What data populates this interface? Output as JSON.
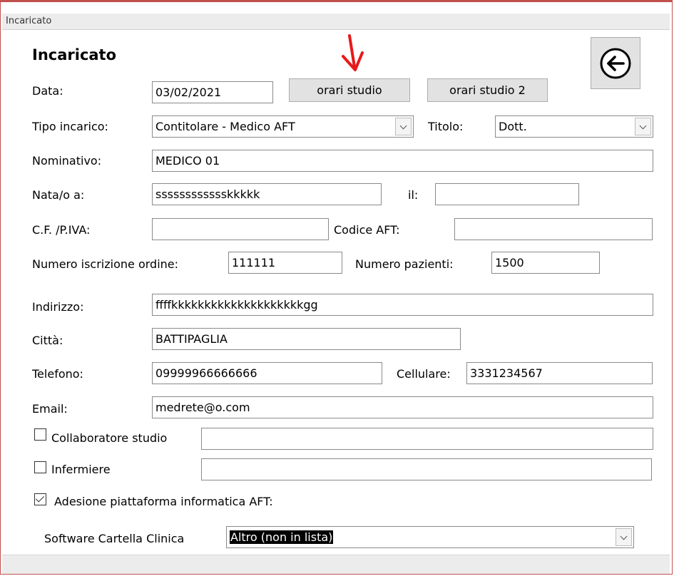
{
  "window": {
    "title": "Incaricato"
  },
  "form": {
    "heading": "Incaricato",
    "data_label": "Data:",
    "data_value": "03/02/2021",
    "orari_studio": "orari studio",
    "orari_studio_2": "orari studio 2",
    "tipo_incarico_label": "Tipo incarico:",
    "tipo_incarico_value": "Contitolare - Medico AFT",
    "titolo_label": "Titolo:",
    "titolo_value": "Dott.",
    "nominativo_label": "Nominativo:",
    "nominativo_value": "MEDICO 01",
    "nato_label": "Nata/o a:",
    "nato_value": "sssssssssssskkkkk",
    "il_label": "il:",
    "il_value": "",
    "cf_label": "C.F. /P.IVA:",
    "cf_value": "",
    "codice_aft_label": "Codice AFT:",
    "codice_aft_value": "",
    "num_iscrizione_label": "Numero iscrizione ordine:",
    "num_iscrizione_value": "111111",
    "num_pazienti_label": "Numero pazienti:",
    "num_pazienti_value": "1500",
    "indirizzo_label": "Indirizzo:",
    "indirizzo_value": "ffffkkkkkkkkkkkkkkkkkkkkgg",
    "citta_label": "Città:",
    "citta_value": "BATTIPAGLIA",
    "telefono_label": "Telefono:",
    "telefono_value": "09999966666666",
    "cellulare_label": "Cellulare:",
    "cellulare_value": "3331234567",
    "email_label": "Email:",
    "email_value": "medrete@o.com",
    "collaboratore_label": "Collaboratore studio",
    "collaboratore_checked": false,
    "collaboratore_value": "",
    "infermiere_label": "Infermiere",
    "infermiere_checked": false,
    "infermiere_value": "",
    "adesione_label": "Adesione piattaforma informatica AFT:",
    "adesione_checked": true,
    "software_label": "Software Cartella Clinica",
    "software_value": "Altro (non in lista)"
  },
  "annotation": {
    "arrow_color": "#e8191b"
  },
  "icons": {
    "back": "arrow-left-circle-icon",
    "dropdown": "chevron-down-icon"
  }
}
